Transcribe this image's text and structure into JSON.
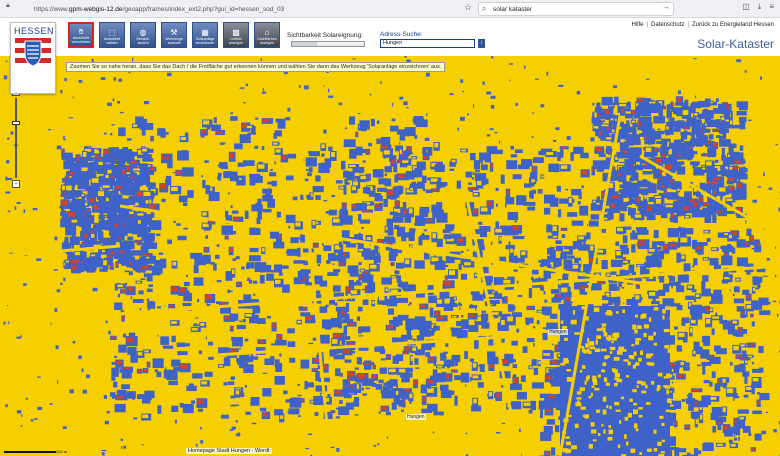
{
  "browser": {
    "url_prefix": "https://www.",
    "url_host": "gpm-webgis-12.de",
    "url_path": "/geoapp/frames/index_ext2.php?gui_id=hessen_sod_03",
    "search_value": "solar kataster"
  },
  "logo": {
    "title": "HESSEN"
  },
  "toolbar": {
    "buttons": [
      {
        "label": "Ausschnitt verschieben",
        "icon": "hand-icon",
        "active": true
      },
      {
        "label": "Ausschnitt wählen",
        "icon": "zoom-box-icon",
        "active": false
      },
      {
        "label": "Gesamt-ansicht",
        "icon": "globe-icon",
        "active": false
      },
      {
        "label": "Werkzeuge auswahl",
        "icon": "tools-icon",
        "active": false
      },
      {
        "label": "Solaranlage einzeichnen",
        "icon": "solar-panel-icon",
        "active": false
      },
      {
        "label": "Luftbild anzeigen",
        "icon": "aerial-photo-icon",
        "active": false
      },
      {
        "label": "Dachflächen anzeigen",
        "icon": "roof-icon",
        "active": false
      }
    ]
  },
  "sichtbarkeit": {
    "label": "Sichtbarkeit Solareignung:",
    "level": 0.35
  },
  "adress": {
    "label": "Adress-Suche:",
    "value": "Hungen",
    "button": "!"
  },
  "toplinks": [
    "Hilfe",
    "Datenschutz",
    "Zurück zu Energieland Hessen"
  ],
  "app_title": "Solar-Kataster",
  "hint": "Zoomen Sie so nahe heran, dass Sie das Dach / die Freifläche gut erkennen können und wählen Sie dann das Werkzeug 'Solaranlage einzeichnen' aus.",
  "zoom": {
    "plus": "+",
    "minus": "−",
    "level": 0.3
  },
  "place_labels": [
    "Hungen",
    "Hungen"
  ],
  "footer_link": "Homepage Stadt Hungen - Wordt",
  "scale": {
    "label": "200 m"
  },
  "colors": {
    "suitable": "#f6cf00",
    "unsuitable": "#3f62c8",
    "roof_red": "#d6422b"
  }
}
